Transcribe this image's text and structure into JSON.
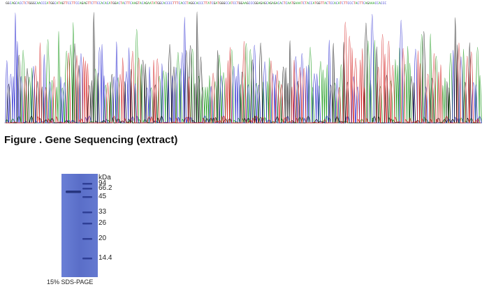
{
  "sequence": "GGCAGCACCTCTGGGCAACCCATGGCATAGTTCCTTCCAGAGTTCTTCCACACATGGACTACTTCAAGTACAGAATATGGCACCCCTTTCACCTAGGCACCCTTATCGATGGGCCATCCTGGAAGCCCGGAGAGCAGAGACACTCAATGAAATCTACCATGGTTACTCCACATCTTCCCTACTTCAGAAACCACCC",
  "figure_caption": "Figure . Gene Sequencing (extract)",
  "gel": {
    "unit": "kDa",
    "markers": [
      "94",
      "66.2",
      "45",
      "33",
      "26",
      "20",
      "14.4"
    ],
    "caption": "15% SDS-PAGE",
    "lane_color": "#5a6ec8",
    "band_color": "#2b3a8c"
  },
  "trace_colors": {
    "A": "#1a9a1a",
    "C": "#2b2bd0",
    "G": "#111111",
    "T": "#d42020"
  }
}
